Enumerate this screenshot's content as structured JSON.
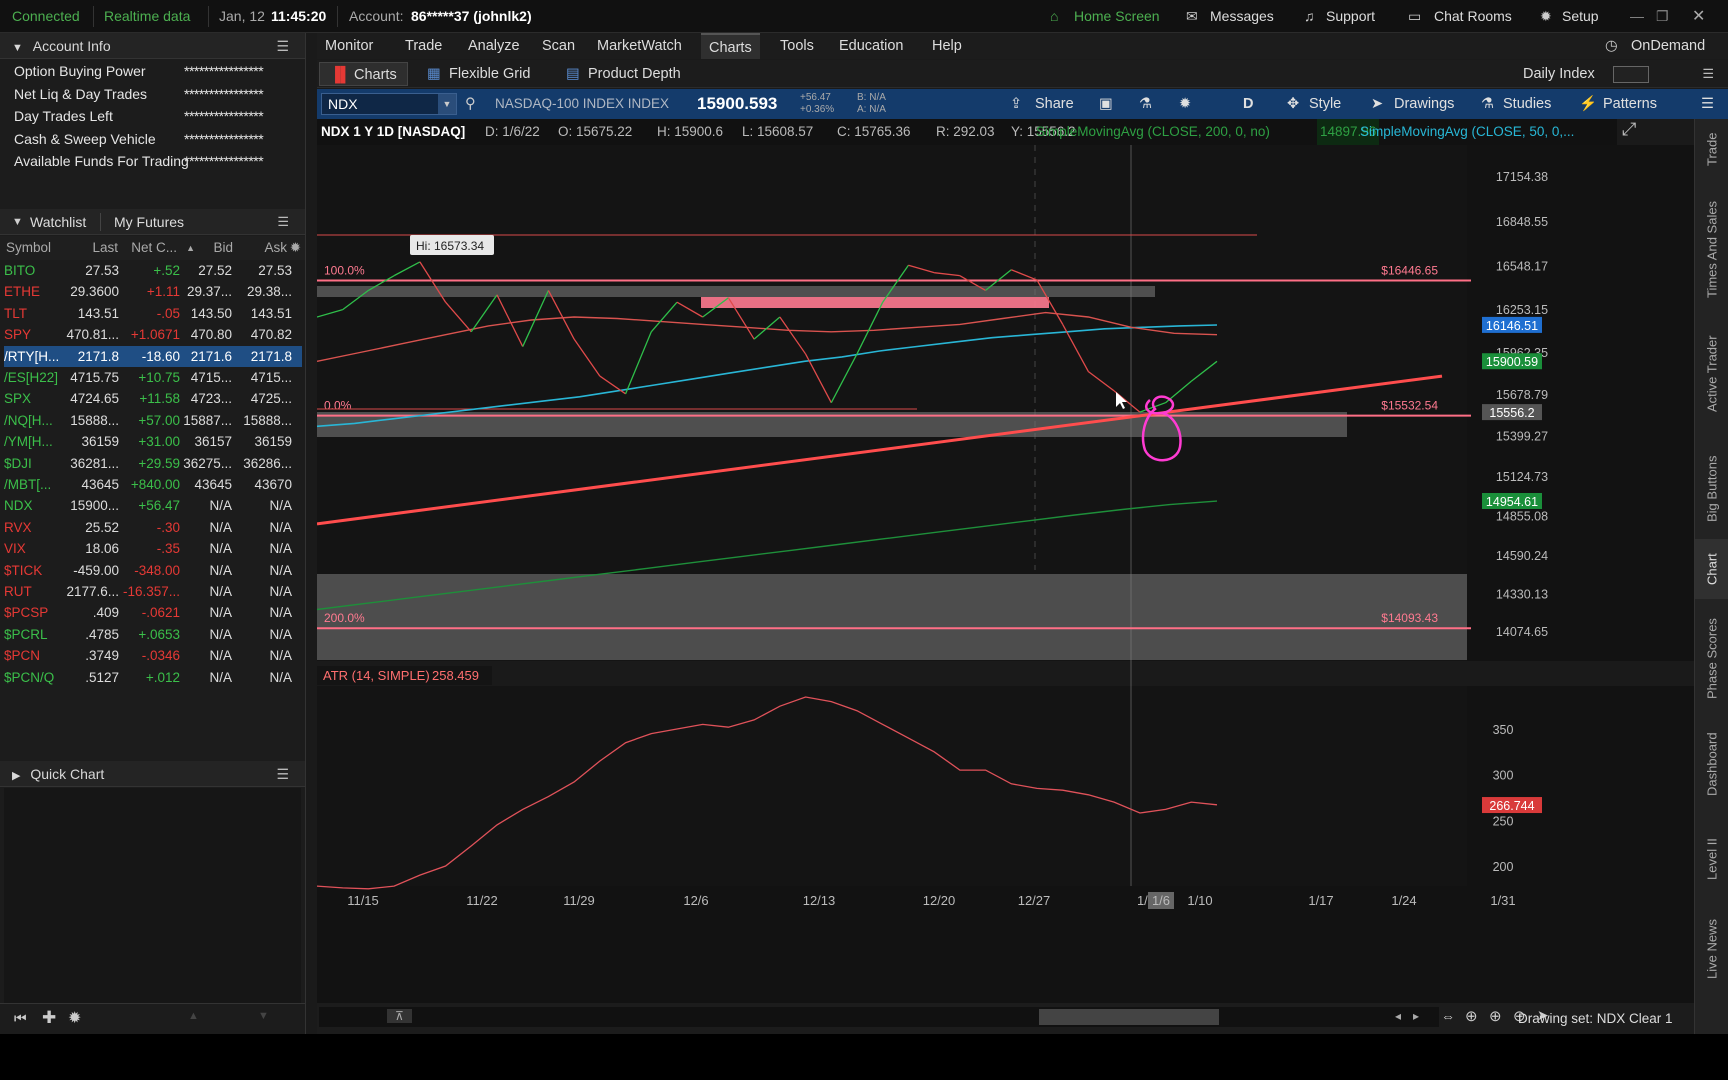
{
  "topbar": {
    "connected": "Connected",
    "realtime": "Realtime data",
    "date": "Jan, 12",
    "time": "11:45:20",
    "account_label": "Account:",
    "account_value": "86*****37 (johnlk2)",
    "home": "Home Screen",
    "messages": "Messages",
    "support": "Support",
    "chat_rooms": "Chat Rooms",
    "setup": "Setup"
  },
  "account_info": {
    "title": "Account Info",
    "rows": [
      {
        "label": "Option Buying Power",
        "value": "****************"
      },
      {
        "label": "Net Liq & Day Trades",
        "value": "****************"
      },
      {
        "label": "Day Trades Left",
        "value": "****************"
      },
      {
        "label": "Cash & Sweep Vehicle",
        "value": "****************"
      },
      {
        "label": "Available Funds For Trading",
        "value": "****************"
      }
    ]
  },
  "watchlist": {
    "tab1": "Watchlist",
    "tab2": "My Futures",
    "headers": {
      "symbol": "Symbol",
      "last": "Last",
      "net": "Net C...",
      "bid": "Bid",
      "ask": "Ask"
    },
    "rows": [
      {
        "sym": "BITO",
        "last": "27.53",
        "net": "+.52",
        "bid": "27.52",
        "ask": "27.53",
        "color": "green"
      },
      {
        "sym": "ETHE",
        "last": "29.3600",
        "net": "+1.11",
        "bid": "29.37...",
        "ask": "29.38...",
        "color": "red"
      },
      {
        "sym": "TLT",
        "last": "143.51",
        "net": "-.05",
        "bid": "143.50",
        "ask": "143.51",
        "color": "red"
      },
      {
        "sym": "SPY",
        "last": "470.81...",
        "net": "+1.0671",
        "bid": "470.80",
        "ask": "470.82",
        "color": "red"
      },
      {
        "sym": "/RTY[H...",
        "last": "2171.8",
        "net": "-18.60",
        "bid": "2171.6",
        "ask": "2171.8",
        "color": "white",
        "selected": true
      },
      {
        "sym": "/ES[H22]",
        "last": "4715.75",
        "net": "+10.75",
        "bid": "4715...",
        "ask": "4715...",
        "color": "green"
      },
      {
        "sym": "SPX",
        "last": "4724.65",
        "net": "+11.58",
        "bid": "4723...",
        "ask": "4725...",
        "color": "green"
      },
      {
        "sym": "/NQ[H...",
        "last": "15888...",
        "net": "+57.00",
        "bid": "15887...",
        "ask": "15888...",
        "color": "green"
      },
      {
        "sym": "/YM[H...",
        "last": "36159",
        "net": "+31.00",
        "bid": "36157",
        "ask": "36159",
        "color": "green"
      },
      {
        "sym": "$DJI",
        "last": "36281...",
        "net": "+29.59",
        "bid": "36275...",
        "ask": "36286...",
        "color": "green"
      },
      {
        "sym": "/MBT[...",
        "last": "43645",
        "net": "+840.00",
        "bid": "43645",
        "ask": "43670",
        "color": "green"
      },
      {
        "sym": "NDX",
        "last": "15900...",
        "net": "+56.47",
        "bid": "N/A",
        "ask": "N/A",
        "color": "green"
      },
      {
        "sym": "RVX",
        "last": "25.52",
        "net": "-.30",
        "bid": "N/A",
        "ask": "N/A",
        "color": "red"
      },
      {
        "sym": "VIX",
        "last": "18.06",
        "net": "-.35",
        "bid": "N/A",
        "ask": "N/A",
        "color": "red"
      },
      {
        "sym": "$TICK",
        "last": "-459.00",
        "net": "-348.00",
        "bid": "N/A",
        "ask": "N/A",
        "color": "red"
      },
      {
        "sym": "RUT",
        "last": "2177.6...",
        "net": "-16.357...",
        "bid": "N/A",
        "ask": "N/A",
        "color": "red"
      },
      {
        "sym": "$PCSP",
        "last": ".409",
        "net": "-.0621",
        "bid": "N/A",
        "ask": "N/A",
        "color": "red"
      },
      {
        "sym": "$PCRL",
        "last": ".4785",
        "net": "+.0653",
        "bid": "N/A",
        "ask": "N/A",
        "color": "green"
      },
      {
        "sym": "$PCN",
        "last": ".3749",
        "net": "-.0346",
        "bid": "N/A",
        "ask": "N/A",
        "color": "red"
      },
      {
        "sym": "$PCN/Q",
        "last": ".5127",
        "net": "+.012",
        "bid": "N/A",
        "ask": "N/A",
        "color": "green"
      }
    ]
  },
  "quick_chart": {
    "title": "Quick Chart"
  },
  "nav": {
    "items": [
      "Monitor",
      "Trade",
      "Analyze",
      "Scan",
      "MarketWatch",
      "Charts",
      "Tools",
      "Education",
      "Help"
    ],
    "ondemand": "OnDemand"
  },
  "subtabs": {
    "charts": "Charts",
    "flexible_grid": "Flexible Grid",
    "product_depth": "Product Depth",
    "daily_index": "Daily Index"
  },
  "toolbar": {
    "symbol": "NDX",
    "description": "NASDAQ-100 INDEX INDEX",
    "price": "15900.593",
    "change": "+56.47",
    "change_pct": "+0.36%",
    "bid": "B: N/A",
    "ask": "A: N/A",
    "share": "Share",
    "period": "D",
    "style": "Style",
    "drawings": "Drawings",
    "studies": "Studies",
    "patterns": "Patterns"
  },
  "infobar": {
    "title": "NDX 1 Y 1D [NASDAQ]",
    "d": "D: 1/6/22",
    "o": "O: 15675.22",
    "h": "H: 15900.6",
    "l": "L: 15608.57",
    "c": "C: 15765.36",
    "r": "R: 292.03",
    "y": "Y: 15556.2",
    "sma200": "SimpleMovingAvg (CLOSE, 200, 0, no)",
    "sma200_val": "14897.96",
    "sma50": "SimpleMovingAvg (CLOSE, 50, 0,..."
  },
  "chart_data": {
    "type": "line",
    "price_axis_labels": [
      "17154.38",
      "16848.55",
      "16548.17",
      "16253.15",
      "15962.35",
      "15678.79",
      "15399.27",
      "15124.73",
      "14855.08",
      "14590.24",
      "14330.13",
      "14074.65"
    ],
    "date_labels": [
      "11/15",
      "11/22",
      "11/29",
      "12/6",
      "12/13",
      "12/20",
      "12/27",
      "1/3",
      "1/6",
      "1/10",
      "1/17",
      "1/24",
      "1/31"
    ],
    "hi_label": "Hi: 16573.34",
    "fib_levels": [
      {
        "pct": "100.0%",
        "price": "$16446.65",
        "value": 16446.65
      },
      {
        "pct": "0.0%",
        "price": "$15532.54",
        "value": 15532.54
      },
      {
        "pct": "200.0%",
        "price": "$14093.43",
        "value": 14093.43
      }
    ],
    "price_tags": [
      {
        "label": "16146.51",
        "value": 16146.51,
        "color": "#1f6fd1"
      },
      {
        "label": "15900.59",
        "value": 15900.59,
        "color": "#1a8f3a"
      },
      {
        "label": "15556.2",
        "value": 15556.2,
        "color": "#555555"
      },
      {
        "label": "14954.61",
        "value": 14954.61,
        "color": "#1a8f3a"
      }
    ],
    "price_series": [
      16200,
      16250,
      16380,
      16480,
      16573,
      16300,
      16100,
      16350,
      16000,
      16380,
      16050,
      15800,
      15680,
      16100,
      16300,
      16200,
      16330,
      16050,
      16200,
      15950,
      15620,
      15950,
      16300,
      16550,
      16500,
      16480,
      16380,
      16520,
      16450,
      16150,
      15830,
      15700,
      15556,
      15620,
      15765,
      15900
    ],
    "sma50_series": [
      15460,
      15480,
      15510,
      15540,
      15570,
      15600,
      15630,
      15660,
      15700,
      15740,
      15780,
      15820,
      15860,
      15900,
      15930,
      15970,
      16000,
      16030,
      16060,
      16080,
      16100,
      16120,
      16130,
      16140,
      16146
    ],
    "sma20_series": [
      15900,
      15960,
      16020,
      16080,
      16140,
      16180,
      16200,
      16190,
      16170,
      16150,
      16130,
      16110,
      16100,
      16110,
      16130,
      16150,
      16190,
      16230,
      16200,
      16130,
      16090,
      16080
    ],
    "sma200_series": [
      14220,
      14260,
      14300,
      14340,
      14380,
      14420,
      14460,
      14500,
      14540,
      14580,
      14620,
      14660,
      14700,
      14740,
      14780,
      14820,
      14860,
      14897,
      14930,
      14954
    ],
    "trendline": {
      "from": 14800,
      "to": 15800
    },
    "atr": {
      "label": "ATR (14, SIMPLE)",
      "value": "258.459",
      "last_tag": "266.744",
      "axis_labels": [
        "350",
        "300",
        "250",
        "200"
      ],
      "series": [
        178,
        176,
        175,
        178,
        190,
        200,
        222,
        245,
        262,
        276,
        292,
        315,
        335,
        345,
        350,
        355,
        352,
        360,
        375,
        385,
        380,
        370,
        355,
        340,
        325,
        305,
        305,
        290,
        285,
        283,
        278,
        270,
        258,
        262,
        270,
        267
      ]
    }
  },
  "right_tabs": [
    "Trade",
    "Times And Sales",
    "Active Trader",
    "Big Buttons",
    "Chart",
    "Phase Scores",
    "Dashboard",
    "Level II",
    "Live News"
  ],
  "statusbar": {
    "drawing_set": "Drawing set: NDX Clear 1"
  }
}
